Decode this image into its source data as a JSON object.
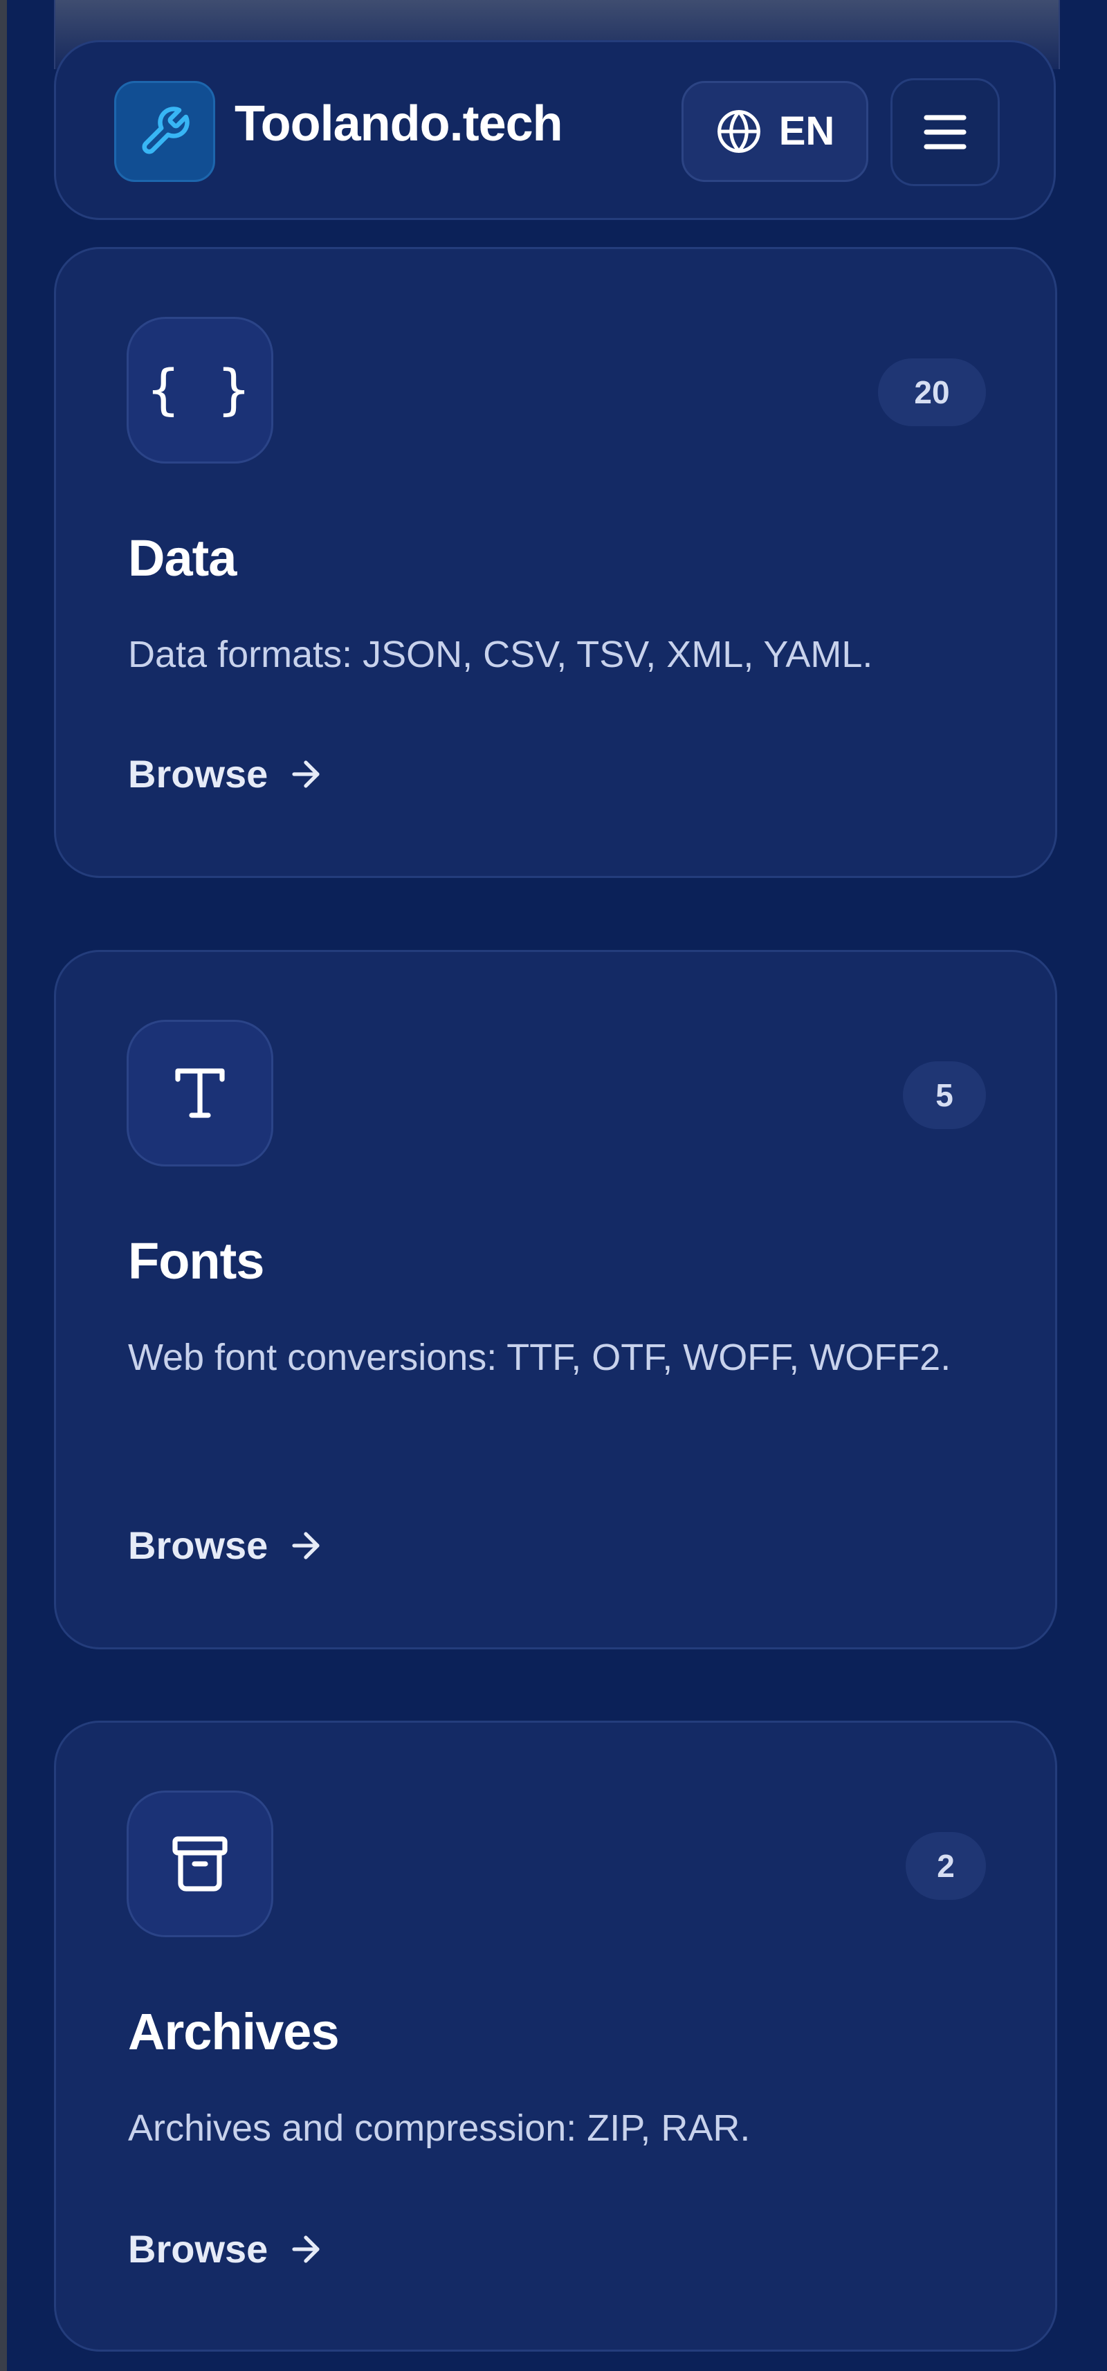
{
  "header": {
    "brand": "Toolando.tech",
    "logo_icon": "wrench-icon",
    "language": {
      "icon": "globe-icon",
      "label": "EN"
    },
    "menu_icon": "hamburger-menu-icon"
  },
  "categories": [
    {
      "icon": "braces-icon",
      "icon_glyph": "{ }",
      "count": "20",
      "title": "Data",
      "description": "Data formats: JSON, CSV, TSV, XML, YAML.",
      "link_label": "Browse",
      "link_icon": "arrow-right-icon"
    },
    {
      "icon": "text-type-icon",
      "count": "5",
      "title": "Fonts",
      "description": "Web font conversions: TTF, OTF, WOFF, WOFF2.",
      "link_label": "Browse",
      "link_icon": "arrow-right-icon"
    },
    {
      "icon": "archive-box-icon",
      "count": "2",
      "title": "Archives",
      "description": "Archives and compression: ZIP, RAR.",
      "link_label": "Browse",
      "link_icon": "arrow-right-icon"
    }
  ],
  "colors": {
    "background": "#0b2158",
    "card": "#142a65",
    "accent": "#38b6f5",
    "text": "#ffffff",
    "muted_text": "#c8d2ec"
  }
}
